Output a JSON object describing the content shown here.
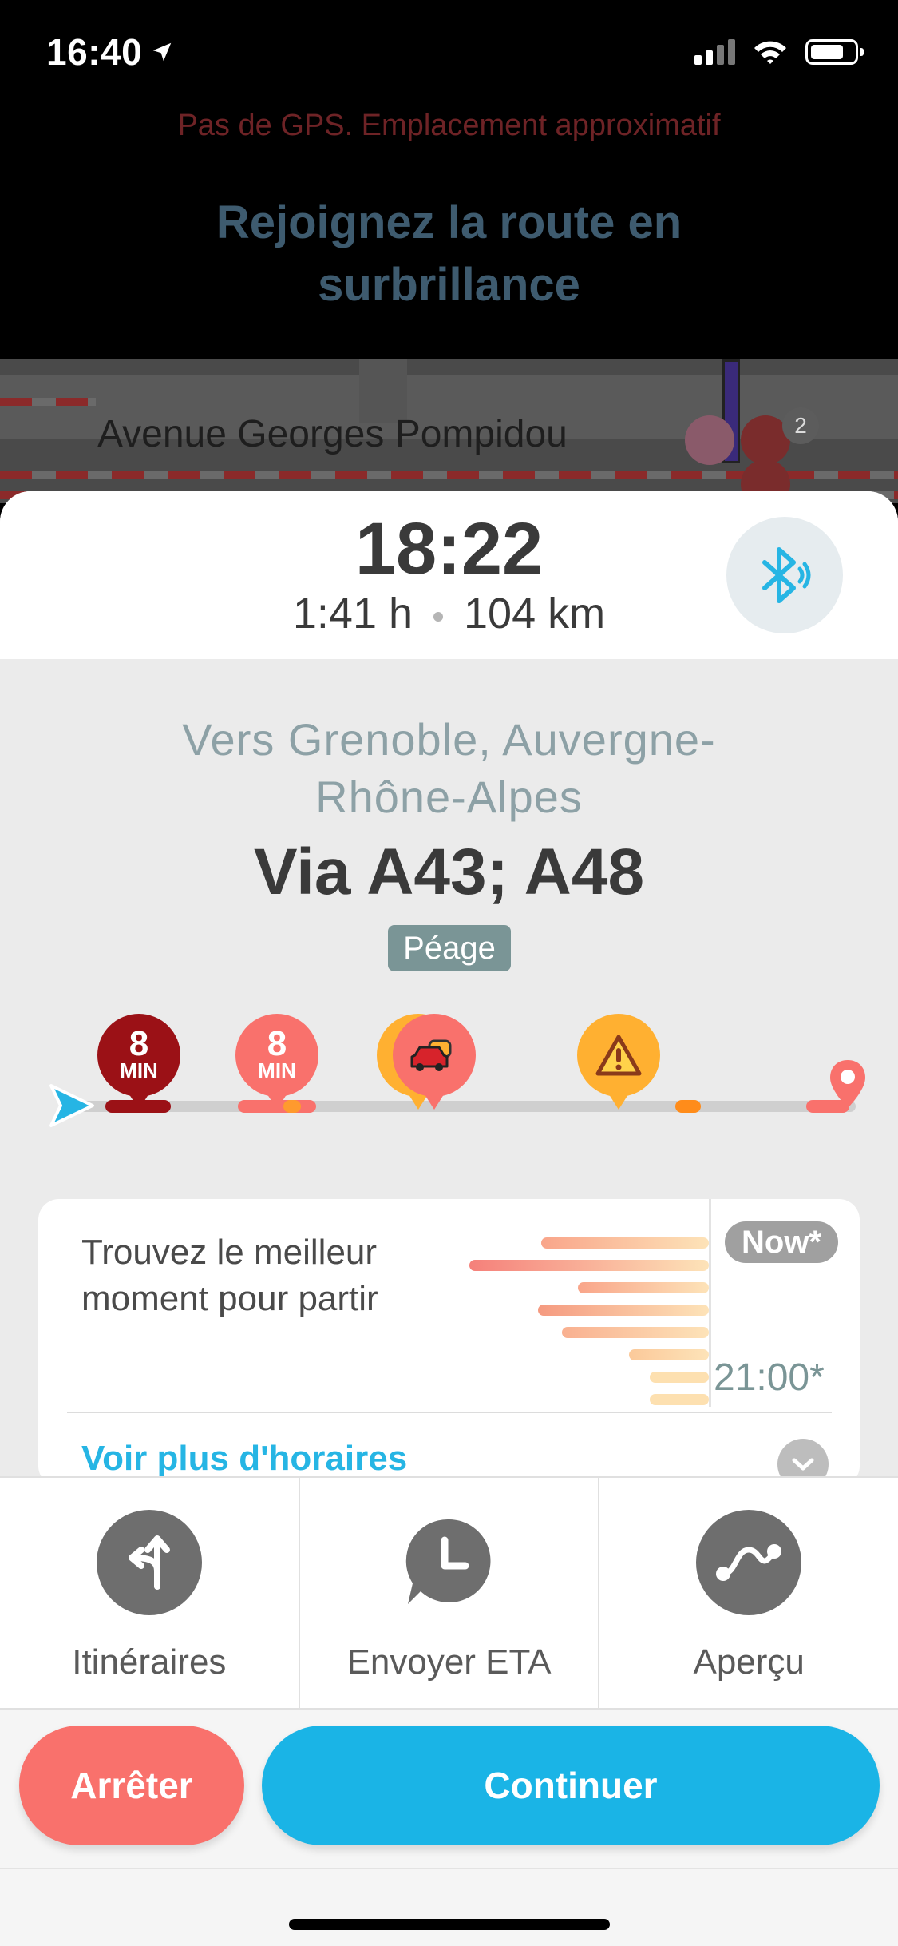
{
  "status_bar": {
    "time": "16:40"
  },
  "banner": {
    "gps_warning": "Pas de GPS. Emplacement approximatif",
    "instruction": "Rejoignez la route en surbrillance"
  },
  "map": {
    "street_name": "Avenue Georges Pompidou",
    "report_count": "2"
  },
  "eta": {
    "arrival": "18:22",
    "duration": "1:41 h",
    "distance": "104 km"
  },
  "route": {
    "destination": "Vers Grenoble, Auvergne-Rhône-Alpes",
    "via": "Via A43; A48",
    "toll_badge": "Péage"
  },
  "timeline": {
    "delays": [
      {
        "value": "8",
        "unit": "MIN",
        "color": "#9b1116"
      },
      {
        "value": "8",
        "unit": "MIN",
        "color": "#f9716c"
      }
    ],
    "icons": [
      "traffic-jam-icon",
      "hazard-warning-icon",
      "destination-pin-icon",
      "start-arrow-icon"
    ]
  },
  "best_time_card": {
    "text": "Trouvez le meilleur moment pour partir",
    "now_label": "Now*",
    "later_label": "21:00*",
    "more_link": "Voir plus d'horaires"
  },
  "actions": [
    {
      "label": "Itinéraires",
      "icon": "route-split-icon"
    },
    {
      "label": "Envoyer ETA",
      "icon": "clock-chat-icon"
    },
    {
      "label": "Aperçu",
      "icon": "overview-route-icon"
    }
  ],
  "buttons": {
    "stop": "Arrêter",
    "continue": "Continuer"
  },
  "colors": {
    "accent": "#1ab4e6",
    "stop": "#f9716c",
    "heavy_traffic": "#9b1116",
    "moderate_traffic": "#f9716c",
    "warning": "#ffb031"
  }
}
